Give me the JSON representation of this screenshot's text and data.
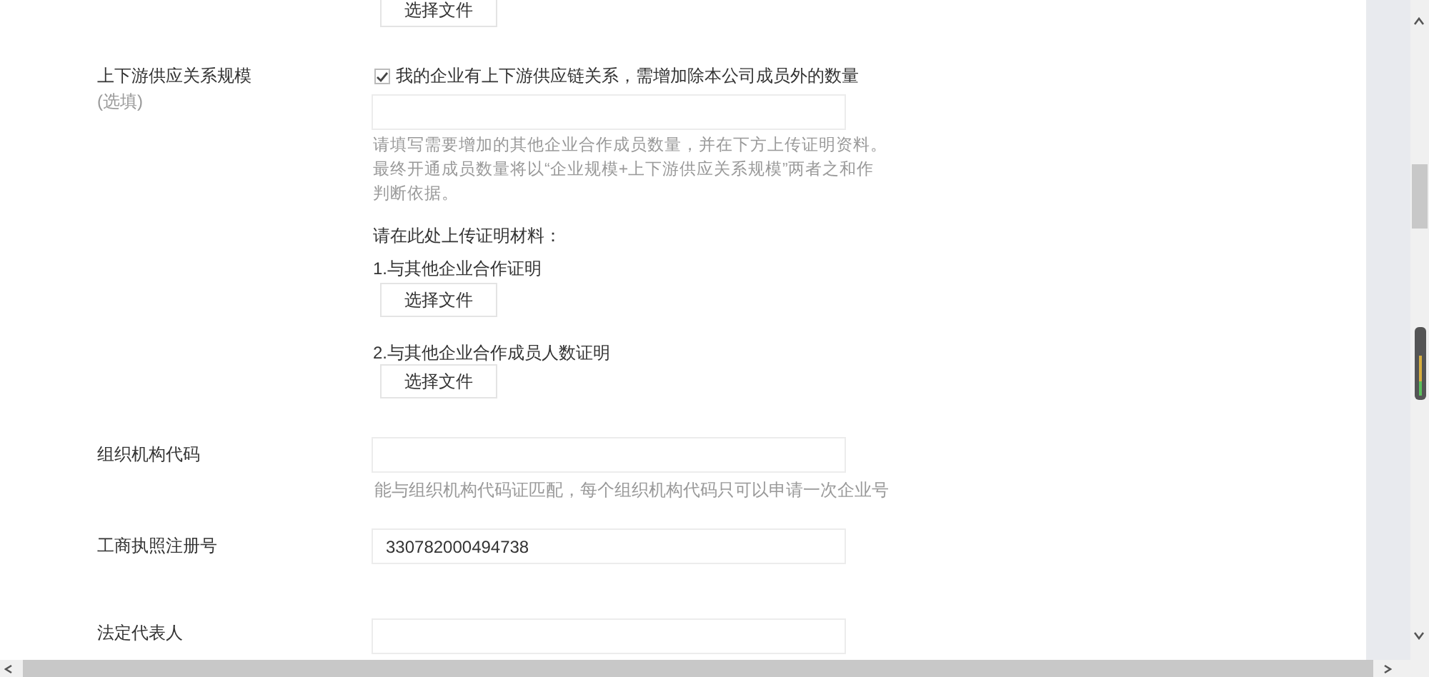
{
  "top_upload": {
    "button": "选择文件"
  },
  "supply_chain": {
    "label": "上下游供应关系规模",
    "optional": "(选填)",
    "checkbox": {
      "label": "我的企业有上下游供应链关系，需增加除本公司成员外的数量",
      "checked": true
    },
    "hint": "请填写需要增加的其他企业合作成员数量，并在下方上传证明资料。最终开通成员数量将以“企业规模+上下游供应关系规模”两者之和作判断依据。",
    "upload_prompt": "请在此处上传证明材料：",
    "uploads": [
      {
        "label": "1.与其他企业合作证明",
        "button": "选择文件"
      },
      {
        "label": "2.与其他企业合作成员人数证明",
        "button": "选择文件"
      }
    ]
  },
  "org_code": {
    "label": "组织机构代码",
    "hint": "能与组织机构代码证匹配，每个组织机构代码只可以申请一次企业号"
  },
  "business_license": {
    "label": "工商执照注册号",
    "value": "330782000494738"
  },
  "legal_rep": {
    "label": "法定代表人"
  }
}
